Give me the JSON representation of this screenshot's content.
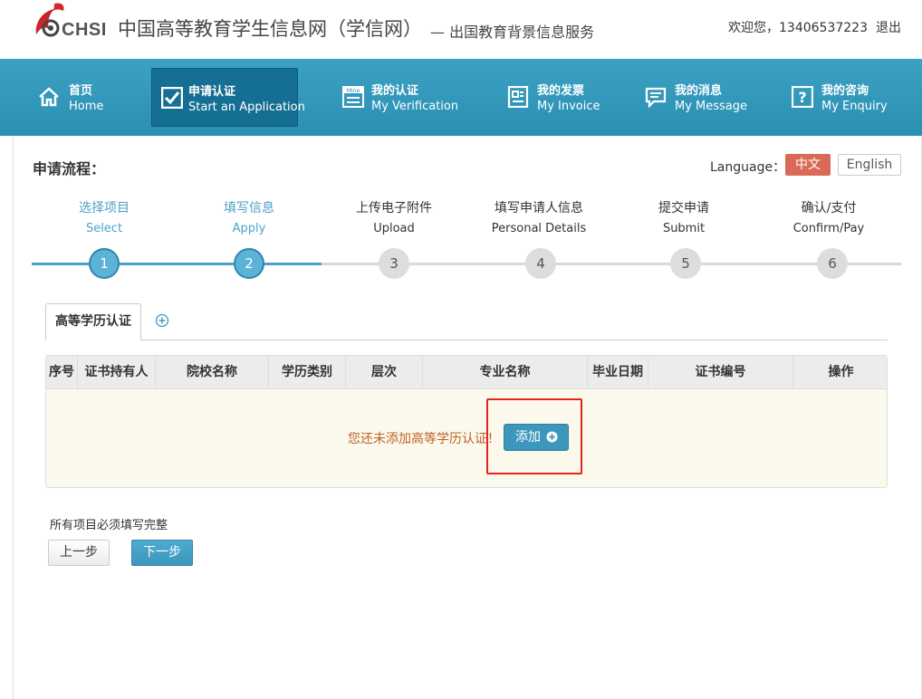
{
  "header": {
    "logo_text": "CHSI",
    "site_title": "中国高等教育学生信息网（学信网）",
    "site_subtitle": "— 出国教育背景信息服务",
    "welcome": "欢迎您，13406537223",
    "logout": "退出"
  },
  "nav": [
    {
      "zh": "首页",
      "en": "Home",
      "icon": "home-icon",
      "active": false
    },
    {
      "zh": "申请认证",
      "en": "Start an Application",
      "icon": "check-icon",
      "active": true
    },
    {
      "zh": "我的认证",
      "en": "My Verification",
      "icon": "mine-icon",
      "active": false
    },
    {
      "zh": "我的发票",
      "en": "My Invoice",
      "icon": "invoice-icon",
      "active": false
    },
    {
      "zh": "我的消息",
      "en": "My Message",
      "icon": "message-icon",
      "active": false
    },
    {
      "zh": "我的咨询",
      "en": "My Enquiry",
      "icon": "enquiry-icon",
      "active": false
    }
  ],
  "flow": {
    "title": "申请流程：",
    "language_label": "Language：",
    "lang_zh": "中文",
    "lang_en": "English"
  },
  "steps": [
    {
      "zh": "选择项目",
      "en": "Select",
      "num": "1",
      "done": true
    },
    {
      "zh": "填写信息",
      "en": "Apply",
      "num": "2",
      "done": true
    },
    {
      "zh": "上传电子附件",
      "en": "Upload",
      "num": "3",
      "done": false
    },
    {
      "zh": "填写申请人信息",
      "en": "Personal Details",
      "num": "4",
      "done": false
    },
    {
      "zh": "提交申请",
      "en": "Submit",
      "num": "5",
      "done": false
    },
    {
      "zh": "确认/支付",
      "en": "Confirm/Pay",
      "num": "6",
      "done": false
    }
  ],
  "tabs": {
    "active_label": "高等学历认证"
  },
  "table": {
    "columns": [
      "序号",
      "证书持有人",
      "院校名称",
      "学历类别",
      "层次",
      "专业名称",
      "毕业日期",
      "证书编号",
      "操作"
    ],
    "empty_message": "您还未添加高等学历认证！",
    "add_label": "添加"
  },
  "footer": {
    "note": "所有项目必须填写完整",
    "prev": "上一步",
    "next": "下一步"
  },
  "colors": {
    "nav_bg": "#3ca1c3",
    "nav_active": "#156f93",
    "step_done": "#4aa3c9",
    "lang_active": "#d96a57",
    "highlight": "#e8231f"
  }
}
